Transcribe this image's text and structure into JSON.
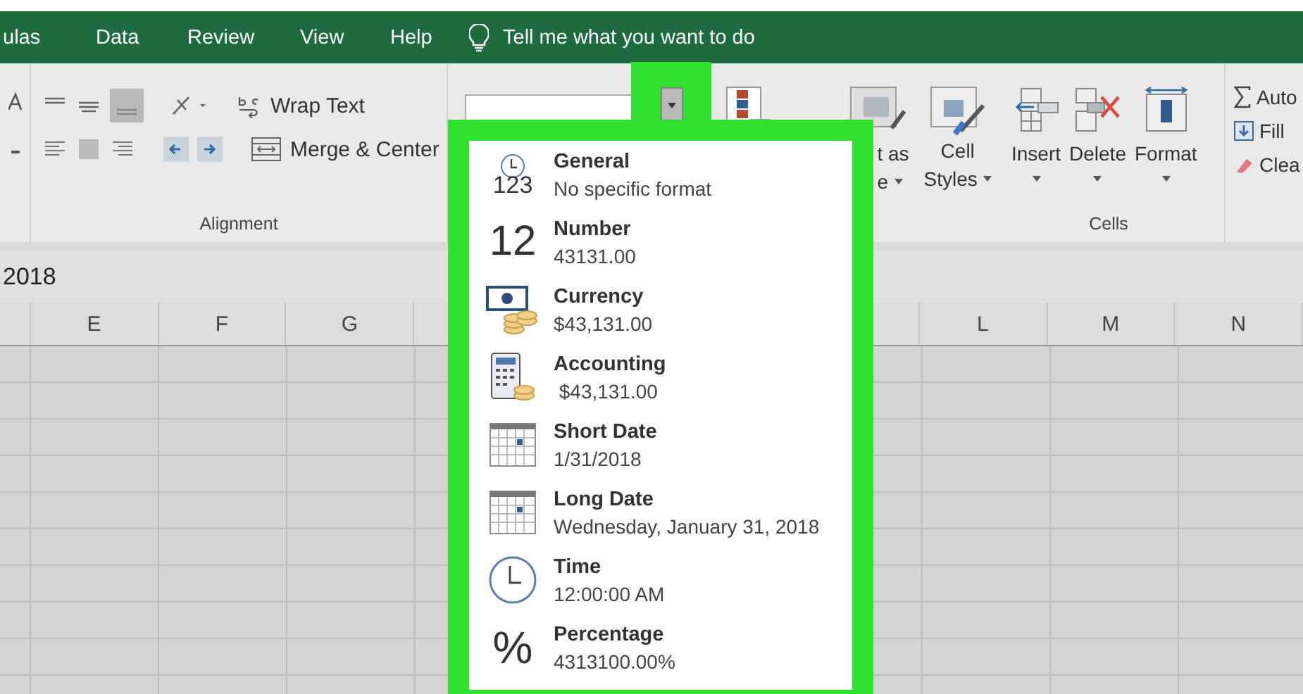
{
  "tabs": [
    {
      "label": "ulas"
    },
    {
      "label": "Data"
    },
    {
      "label": "Review"
    },
    {
      "label": "View"
    },
    {
      "label": "Help"
    }
  ],
  "tell_me": "Tell me what you want to do",
  "ribbon": {
    "alignment": {
      "wrap_text": "Wrap Text",
      "merge_center": "Merge & Center",
      "label": "Alignment"
    },
    "styles": {
      "format_as_table": [
        "t as",
        "e"
      ],
      "cell_styles": [
        "Cell",
        "Styles"
      ]
    },
    "cells": {
      "buttons": [
        {
          "label": "Insert",
          "kind": "insert"
        },
        {
          "label": "Delete",
          "kind": "delete"
        },
        {
          "label": "Format",
          "kind": "format"
        }
      ],
      "label": "Cells"
    },
    "editing": [
      {
        "label": "Auto",
        "kind": "sum"
      },
      {
        "label": "Fill",
        "kind": "fill"
      },
      {
        "label": "Clea",
        "kind": "clear"
      }
    ]
  },
  "formula_bar": {
    "value": "2018"
  },
  "columns_left": [
    "E",
    "F",
    "G"
  ],
  "columns_right": [
    "L",
    "M",
    "N"
  ],
  "number_format_menu": [
    {
      "kind": "general",
      "icon_text": "123",
      "title": "General",
      "example": "No specific format"
    },
    {
      "kind": "number",
      "icon_text": "12",
      "title": "Number",
      "example": "43131.00"
    },
    {
      "kind": "currency",
      "title": "Currency",
      "example": "$43,131.00"
    },
    {
      "kind": "accounting",
      "title": "Accounting",
      "example": " $43,131.00"
    },
    {
      "kind": "short_date",
      "title": "Short Date",
      "example": "1/31/2018"
    },
    {
      "kind": "long_date",
      "title": "Long Date",
      "example": "Wednesday, January 31, 2018"
    },
    {
      "kind": "time",
      "title": "Time",
      "example": "12:00:00 AM"
    },
    {
      "kind": "percentage",
      "icon_text": "%",
      "title": "Percentage",
      "example": "4313100.00%"
    }
  ]
}
